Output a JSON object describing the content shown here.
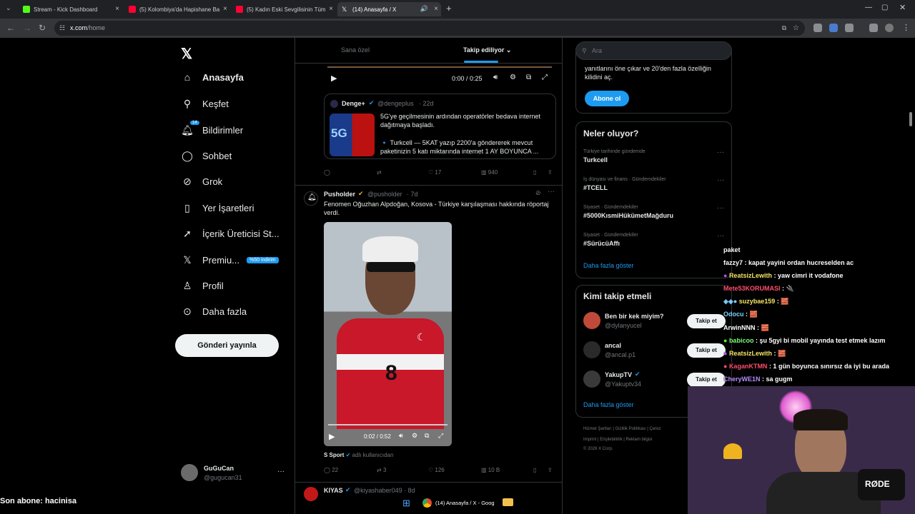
{
  "browser": {
    "tabs": [
      {
        "title": "Stream - Kick Dashboard",
        "color": "#53fc18"
      },
      {
        "title": "(5) Kolombiya'da Hapishane Ba",
        "color": "#ff0033"
      },
      {
        "title": "(5) Kadın Eski Sevgilisinin Tüm",
        "color": "#ff0033"
      },
      {
        "title": "(14) Anasayfa / X",
        "color": "#ffffff"
      }
    ],
    "url_host": "x.com",
    "url_path": "/home",
    "new_tab": "+"
  },
  "sidebar": {
    "logo": "𝕏",
    "items": [
      {
        "label": "Anasayfa",
        "icon": "home-icon"
      },
      {
        "label": "Keşfet",
        "icon": "search-icon"
      },
      {
        "label": "Bildirimler",
        "icon": "bell-icon",
        "badge": "14"
      },
      {
        "label": "Sohbet",
        "icon": "chat-icon"
      },
      {
        "label": "Grok",
        "icon": "grok-icon"
      },
      {
        "label": "Yer İşaretleri",
        "icon": "bookmark-icon"
      },
      {
        "label": "İçerik Üreticisi St...",
        "icon": "rocket-icon"
      },
      {
        "label": "Premiu...",
        "icon": "x-icon",
        "badge": "%50 indirim"
      },
      {
        "label": "Profil",
        "icon": "person-icon"
      },
      {
        "label": "Daha fazla",
        "icon": "more-circle-icon"
      }
    ],
    "post_button": "Gönderi yayınla",
    "profile": {
      "name": "GuGuCan",
      "handle": "@gugucan31",
      "more": "···"
    }
  },
  "timeline": {
    "tabs": {
      "for_you": "Sana özel",
      "following": "Takip ediliyor"
    },
    "player1": {
      "time": "0:00 / 0:25"
    },
    "quote": {
      "author": "Denge+",
      "handle": "@dengeplus",
      "age": "· 22d",
      "text1": "5G'ye geçilmesinin ardından operatörler bedava internet dağıtmaya başladı.",
      "text2": "🔹 Turkcell — 5KAT yazıp 2200'a göndererek mevcut paketinizin 5 katı miktarında internet 1 AY BOYUNCA ..."
    },
    "tweet1_actions": {
      "retweets": "",
      "likes": "17",
      "views": "940"
    },
    "tweet2": {
      "author": "Pusholder",
      "handle": "@pusholder",
      "age": "· 7d",
      "text": "Fenomen Oğuzhan Alpdoğan, Kosova - Türkiye karşılaşması hakkında röportaj verdi.",
      "video_time": "0:02 / 0:52",
      "shirt_number": "8",
      "credit_name": "S Sport",
      "credit_suffix": "adlı kullanıcıdan",
      "replies": "22",
      "retweets": "3",
      "likes": "126",
      "views": "10 B"
    },
    "tweet3": {
      "author": "KIYAS",
      "handle": "@kiyashaber049",
      "age": "· 8d"
    }
  },
  "right": {
    "search_placeholder": "Ara",
    "premium": {
      "text": "yanıtlarını öne çıkar ve 20'den fazla özelliğin kilidini aç.",
      "button": "Abone ol"
    },
    "trends": {
      "title": "Neler oluyor?",
      "items": [
        {
          "category": "Türkiye tarihinde gündemde",
          "name": "Turkcell"
        },
        {
          "category": "İş dünyası ve finans · Gündemdekiler",
          "name": "#TCELL"
        },
        {
          "category": "Siyaset · Gündemdekiler",
          "name": "#5000KısmiHükümetMağduru"
        },
        {
          "category": "Siyaset · Gündemdekiler",
          "name": "#SürücüAffı"
        }
      ],
      "show_more": "Daha fazla göster"
    },
    "who_to_follow": {
      "title": "Kimi takip etmeli",
      "users": [
        {
          "name": "Ben bir kek miyim?",
          "handle": "@dylanyucel",
          "button": "Takip et"
        },
        {
          "name": "ancal",
          "handle": "@ancal.p1",
          "button": "Takip et"
        },
        {
          "name": "YakupTV",
          "handle": "@Yakuptv34",
          "button": "Takip et"
        }
      ],
      "show_more": "Daha fazla göster"
    },
    "footer": {
      "line1": [
        "Hizmet Şartları",
        "Gizlilik Politikası",
        "Çerez"
      ],
      "line2": [
        "Imprint",
        "Erişilebilirlik",
        "Reklam bilgisi"
      ],
      "copyright": "© 2026 X Corp."
    }
  },
  "stream_chat": [
    {
      "user": "",
      "msg": "paket",
      "color": "#ffffff"
    },
    {
      "user": "fazzy7",
      "msg": " : kapat yayini ordan hucreselden ac",
      "color": "#ffffff"
    },
    {
      "user": "ReatsizLewith",
      "msg": " : yaw cimri it vodafone",
      "color": "#f5e663"
    },
    {
      "user": "Mete53KORUMASI",
      "msg": " : 🔌",
      "color": "#ff4d6d"
    },
    {
      "user": "suzybae159",
      "msg": " : 🧱",
      "color": "#f5e663"
    },
    {
      "user": "Odocu",
      "msg": " : 🧱",
      "color": "#7cd3ff"
    },
    {
      "user": "ArwinNNN",
      "msg": " : 🧱",
      "color": "#ffffff"
    },
    {
      "user": "babicoo",
      "msg": " : şu 5gyi bi mobil yayında test etmek lazım",
      "color": "#7cff7c"
    },
    {
      "user": "ReatsizLewith",
      "msg": " : 🧱",
      "color": "#f5e663"
    },
    {
      "user": "KaganKTMN",
      "msg": " : 1 gün boyunca sınırsız da iyi bu arada",
      "color": "#ff4d6d"
    },
    {
      "user": "CheryWE1N",
      "msg": " : sa gugm",
      "color": "#b48cff"
    }
  ],
  "stream_overlay": {
    "last_sub": "Son abone: hacinisa",
    "taskbar_app": "(14) Anasayfa / X - Goog",
    "mic_brand": "RØDE"
  },
  "colors": {
    "accent": "#1d9bf0",
    "bg": "#000000",
    "border": "#2f3336"
  }
}
